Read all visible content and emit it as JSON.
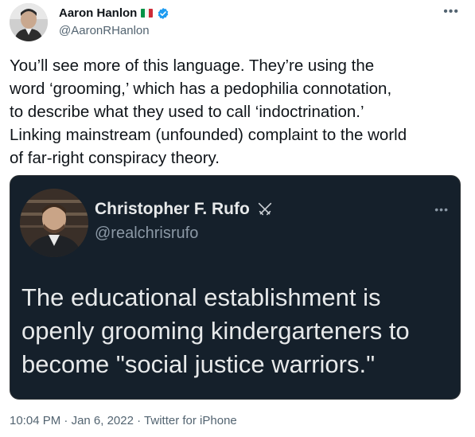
{
  "author": {
    "display_name": "Aaron Hanlon",
    "handle": "@AaronRHanlon",
    "flag_colors": [
      "#009246",
      "#ffffff",
      "#ce2b37"
    ],
    "verified_color": "#1d9bf0"
  },
  "tweet": {
    "text": "You’ll see more of this language. They’re using the\nword ‘grooming,’ which has a pedophilia connotation,\nto describe what they used to call ‘indoctrination.’\nLinking mainstream (unfounded) complaint to the world\nof far-right conspiracy theory.",
    "more_icon": "•••"
  },
  "quoted": {
    "display_name": "Christopher F. Rufo",
    "handle": "@realchrisrufo",
    "text": "The educational establishment is\nopenly grooming kindergarteners to\nbecome \"social justice warriors.\"",
    "more_icon": "•••",
    "card_color": "#15202b",
    "badge_icon": "crossed-swords-icon"
  },
  "meta": {
    "time": "10:04 PM",
    "sep1": " · ",
    "date": "Jan 6, 2022",
    "sep2": " · ",
    "source": "Twitter for iPhone"
  }
}
